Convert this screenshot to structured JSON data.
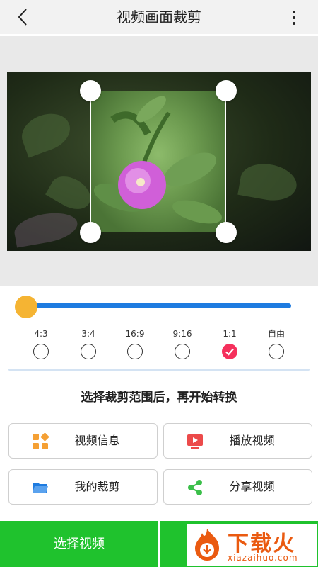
{
  "header": {
    "title": "视频画面裁剪",
    "back_icon": "chevron-left-icon",
    "more_icon": "more-vertical-icon"
  },
  "slider": {
    "value_fraction": 0.0
  },
  "ratios": [
    {
      "label": "4:3",
      "checked": false
    },
    {
      "label": "3:4",
      "checked": false
    },
    {
      "label": "16:9",
      "checked": false
    },
    {
      "label": "9:16",
      "checked": false
    },
    {
      "label": "1:1",
      "checked": true
    },
    {
      "label": "自由",
      "checked": false
    }
  ],
  "instruction": "选择裁剪范围后，再开始转换",
  "actions": {
    "video_info": {
      "label": "视频信息",
      "icon": "grid-apps-icon",
      "color": "#f5a034"
    },
    "play_video": {
      "label": "播放视频",
      "icon": "video-play-icon",
      "color": "#ec4a4a"
    },
    "my_crops": {
      "label": "我的裁剪",
      "icon": "folder-icon",
      "color": "#1e7be0"
    },
    "share_video": {
      "label": "分享视频",
      "icon": "share-icon",
      "color": "#3bbf4a"
    }
  },
  "bottom": {
    "select_label": "选择视频"
  },
  "watermark": {
    "text": "下载火",
    "domain": "xiazaihuo.com"
  },
  "colors": {
    "accent_blue": "#1e7be0",
    "accent_green": "#1fc22d",
    "slider_thumb": "#f5b433",
    "checked_red": "#f5305c"
  }
}
